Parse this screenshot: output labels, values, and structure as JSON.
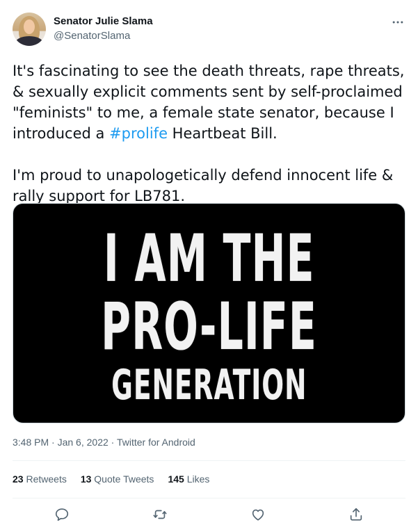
{
  "author": {
    "display_name": "Senator Julie Slama",
    "handle": "@SenatorSlama"
  },
  "tweet": {
    "p1_before": "It's fascinating to see the death threats, rape threats, & sexually explicit comments sent by self-proclaimed \"feminists\" to me, a female state senator, because I introduced a ",
    "hashtag": "#prolife",
    "p1_after": " Heartbeat Bill.",
    "p2": "I'm proud to unapologetically defend innocent life & rally support for LB781."
  },
  "media": {
    "line1": "I AM THE",
    "line2": "PRO-LIFE",
    "line3": "GENERATION"
  },
  "meta": {
    "time": "3:48 PM",
    "sep1": " · ",
    "date": "Jan 6, 2022",
    "sep2": " · ",
    "source": "Twitter for Android"
  },
  "stats": {
    "retweets_count": "23",
    "retweets_label": "Retweets",
    "quotes_count": "13",
    "quotes_label": "Quote Tweets",
    "likes_count": "145",
    "likes_label": "Likes"
  },
  "icons": {
    "more": "more-horizontal-icon",
    "reply": "reply-icon",
    "retweet": "retweet-icon",
    "like": "heart-icon",
    "share": "share-icon"
  },
  "colors": {
    "text": "#0f1419",
    "secondary": "#536471",
    "link": "#1d9bf0",
    "divider": "#eff3f4",
    "media_bg": "#000000"
  }
}
